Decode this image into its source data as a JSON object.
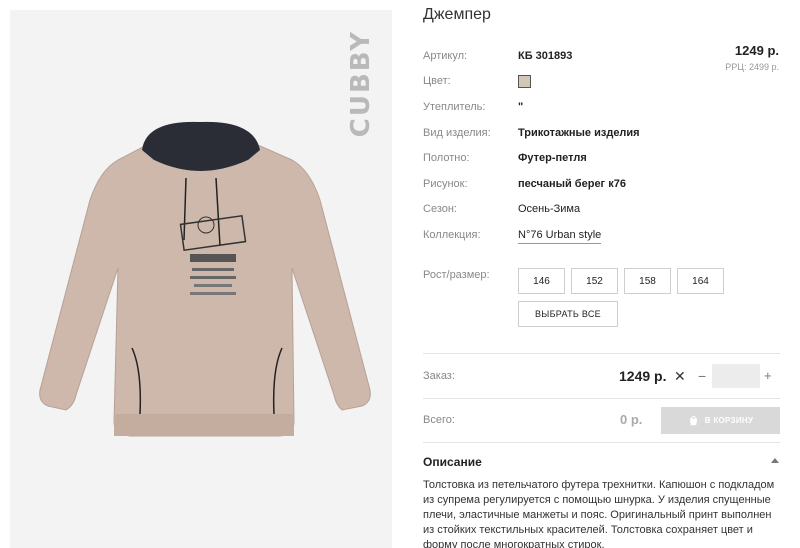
{
  "product": {
    "title": "Джемпер",
    "brand_mark": "CUBBY",
    "price": "1249 р.",
    "rrp": "РРЦ: 2499 р.",
    "swatch_color": "#d2c6b6",
    "attributes": {
      "article": {
        "label": "Артикул:",
        "value": "КБ 301893"
      },
      "color": {
        "label": "Цвет:"
      },
      "insulation": {
        "label": "Утеплитель:",
        "value": "\""
      },
      "type": {
        "label": "Вид изделия:",
        "value": "Трикотажные изделия"
      },
      "fabric": {
        "label": "Полотно:",
        "value": "Футер-петля"
      },
      "pattern": {
        "label": "Рисунок:",
        "value": "песчаный берег к76"
      },
      "season": {
        "label": "Сезон:",
        "value": "Осень-Зима"
      },
      "collection": {
        "label": "Коллекция:",
        "value": "N°76 Urban style"
      }
    }
  },
  "sizes": {
    "label": "Рост/размер:",
    "options": [
      "146",
      "152",
      "158",
      "164"
    ],
    "select_all": "ВЫБРАТЬ ВСЕ"
  },
  "order": {
    "label": "Заказ:",
    "price": "1249 р.",
    "times": "✕",
    "minus": "−",
    "plus": "+",
    "quantity": ""
  },
  "total": {
    "label": "Всего:",
    "value": "0 р.",
    "cart_button": "В КОРЗИНУ"
  },
  "description": {
    "heading": "Описание",
    "text": "Толстовка из петельчатого футера трехнитки. Капюшон с подкладом из супрема регулируется с помощью шнурка. У изделия спущенные плечи, эластичные манжеты и пояс. Оригинальный принт выполнен из стойких текстильных красителей. Толстовка сохраняет цвет и форму после многократных стирок."
  }
}
